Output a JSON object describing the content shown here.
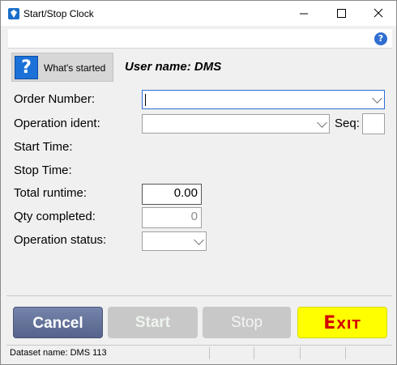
{
  "window": {
    "title": "Start/Stop Clock"
  },
  "toolbar": {
    "help_icon": "question-circle-icon",
    "help_glyph": "?"
  },
  "header": {
    "started_button_label": "What's started",
    "started_button_glyph": "?",
    "user_name": "User name: DMS"
  },
  "form": {
    "order_number": {
      "label": "Order Number:",
      "value": ""
    },
    "operation_ident": {
      "label": "Operation ident:",
      "value": ""
    },
    "seq": {
      "label": "Seq:",
      "value": ""
    },
    "start_time": {
      "label": "Start Time:"
    },
    "stop_time": {
      "label": "Stop Time:"
    },
    "total_runtime": {
      "label": "Total runtime:",
      "value": "0.00"
    },
    "qty_completed": {
      "label": "Qty completed:",
      "value": "0"
    },
    "operation_status": {
      "label": "Operation status:",
      "value": ""
    }
  },
  "buttons": {
    "cancel": "Cancel",
    "start": "Start",
    "stop": "Stop",
    "exit": "Exit"
  },
  "status": {
    "dataset": "Dataset name:  DMS 113"
  },
  "colors": {
    "accent": "#1c71d8",
    "cancel_bg": "#5f6d96",
    "exit_bg": "#ffff00",
    "exit_text": "#d40000",
    "focus_border": "#2b6fd6"
  }
}
